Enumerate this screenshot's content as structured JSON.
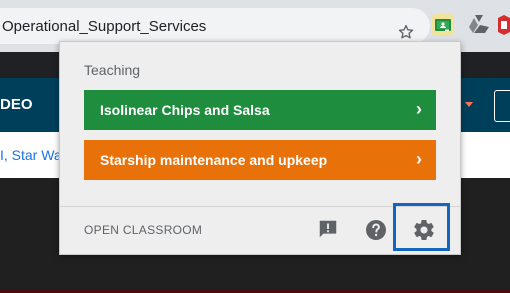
{
  "browser": {
    "url": "Operational_Support_Services"
  },
  "page": {
    "nav_label": "DEO",
    "strip_text": "I, Star Wa"
  },
  "popup": {
    "heading": "Teaching",
    "classes": [
      {
        "label": "Isolinear Chips and Salsa",
        "color": "#1e8e3e",
        "chevron": "›"
      },
      {
        "label": "Starship maintenance and upkeep",
        "color": "#e8710a",
        "chevron": "›"
      }
    ],
    "open_classroom_label": "OPEN CLASSROOM"
  },
  "icons": {
    "star": "star-outline-icon",
    "classroom_extension": "google-classroom-icon",
    "drive_extension": "google-drive-icon",
    "feedback": "feedback-icon",
    "help": "help-icon",
    "settings": "gear-icon"
  },
  "colors": {
    "highlight_border": "#1565c0",
    "nav_background": "#003f5a"
  }
}
